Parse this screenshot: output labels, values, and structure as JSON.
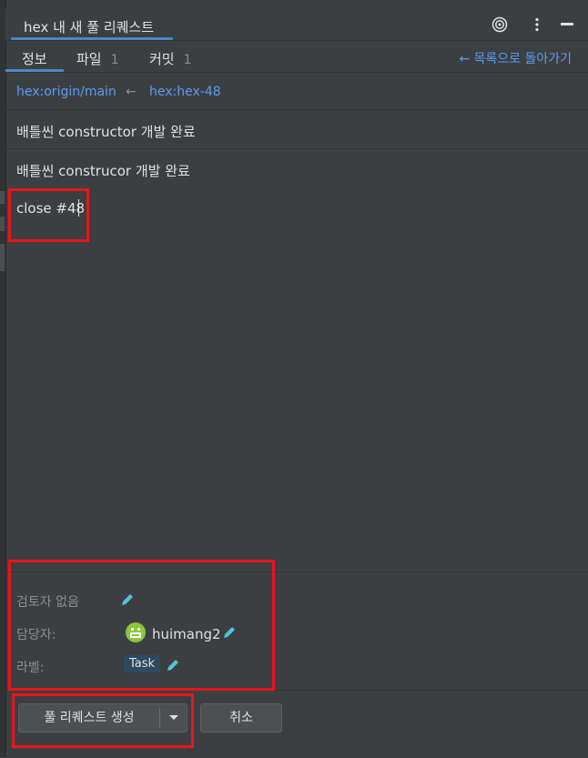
{
  "window": {
    "title": "hex 내 새 풀 리퀘스트"
  },
  "tabs": [
    {
      "label": "정보",
      "count": ""
    },
    {
      "label": "파일",
      "count": "1"
    },
    {
      "label": "커밋",
      "count": "1"
    }
  ],
  "back_link": "← 목록으로 돌아가기",
  "branches": {
    "base": "hex:origin/main",
    "arrow": "←",
    "head": "hex:hex-48"
  },
  "title_input": {
    "value": "배틀씬 constructor 개발 완료"
  },
  "description": {
    "lines": [
      "배틀씬 construcor 개발 완료",
      "close #48"
    ]
  },
  "metadata": {
    "reviewers_label": "검토자 없음",
    "assignee_label": "담당자:",
    "assignee_name": "huimang2",
    "labels_label": "라벨:",
    "label_chip": "Task"
  },
  "actions": {
    "create_label": "풀 리퀘스트 생성",
    "cancel_label": "취소"
  },
  "colors": {
    "accent": "#589df6",
    "highlight": "#e8151b",
    "avatar": "#8cc63f",
    "pencil": "#4fc3d9"
  },
  "icons": [
    "target-icon",
    "more-vertical-icon",
    "minimize-icon",
    "pencil-icon",
    "chevron-down-icon"
  ]
}
